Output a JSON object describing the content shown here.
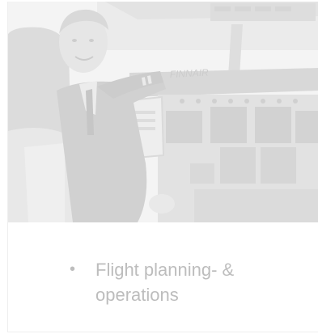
{
  "photo": {
    "subject": "pilot-in-cockpit-photo",
    "tint": "#f0f0f0",
    "cockpit_lettering": "FINNAIR"
  },
  "caption": {
    "bullet": "•",
    "text": "Flight planning- & operations"
  }
}
